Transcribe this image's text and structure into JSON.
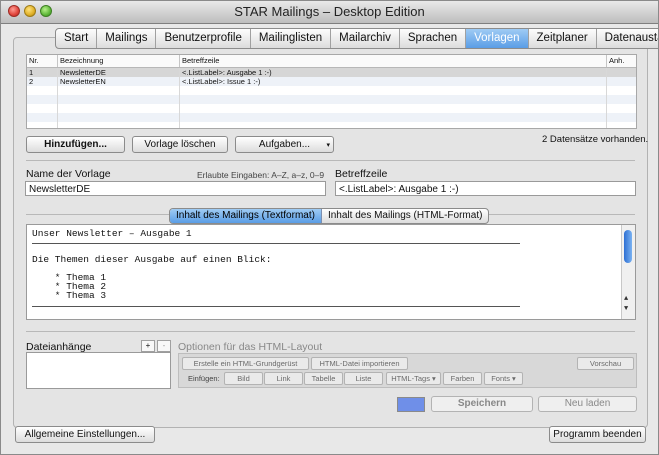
{
  "window": {
    "title": "STAR Mailings – Desktop Edition"
  },
  "tabs": [
    {
      "label": "Start"
    },
    {
      "label": "Mailings"
    },
    {
      "label": "Benutzerprofile"
    },
    {
      "label": "Mailinglisten"
    },
    {
      "label": "Mailarchiv"
    },
    {
      "label": "Sprachen"
    },
    {
      "label": "Vorlagen",
      "active": true
    },
    {
      "label": "Zeitplaner"
    },
    {
      "label": "Datenaustausch"
    }
  ],
  "table": {
    "headers": [
      "Nr.",
      "Bezeichnung",
      "Betreffzeile",
      "Anh."
    ],
    "rows": [
      {
        "nr": "1",
        "name": "NewsletterDE",
        "subject": "<.ListLabel>: Ausgabe 1 :-)",
        "att": ""
      },
      {
        "nr": "2",
        "name": "NewsletterEN",
        "subject": "<.ListLabel>: Issue 1 :-)",
        "att": ""
      }
    ]
  },
  "buttons": {
    "add": "Hinzufügen...",
    "delete": "Vorlage löschen",
    "tasks": "Aufgaben...",
    "save": "Speichern",
    "reload": "Neu laden",
    "general": "Allgemeine Einstellungen...",
    "quit": "Programm beenden"
  },
  "record_count": "2 Datensätze vorhanden.",
  "form": {
    "name_label": "Name der Vorlage",
    "allowed": "Erlaubte Eingaben: A–Z, a–z, 0–9",
    "name_value": "NewsletterDE",
    "subject_label": "Betreffzeile",
    "subject_value": "<.ListLabel>: Ausgabe 1 :-)"
  },
  "content_tabs": {
    "text": "Inhalt des Mailings (Textformat)",
    "html": "Inhalt des Mailings (HTML-Format)"
  },
  "editor": {
    "line1": "Unser Newsletter – Ausgabe 1",
    "line2": "Die Themen dieser Ausgabe auf einen Blick:",
    "item1": "    * Thema 1",
    "item2": "    * Thema 2",
    "item3": "    * Thema 3"
  },
  "attachments": {
    "label": "Dateianhänge",
    "plus": "+",
    "minus": "-"
  },
  "html_options": {
    "label": "Optionen für das HTML-Layout",
    "create": "Erstelle ein HTML-Grundgerüst",
    "import": "HTML-Datei importieren",
    "preview": "Vorschau",
    "insert_label": "Einfügen:",
    "insert": [
      "Bild",
      "Link",
      "Tabelle",
      "Liste",
      "HTML-Tags",
      "Farben",
      "Fonts"
    ]
  },
  "colors": {
    "accent": "#5a9de6",
    "swatch": "#6f8fe8"
  }
}
